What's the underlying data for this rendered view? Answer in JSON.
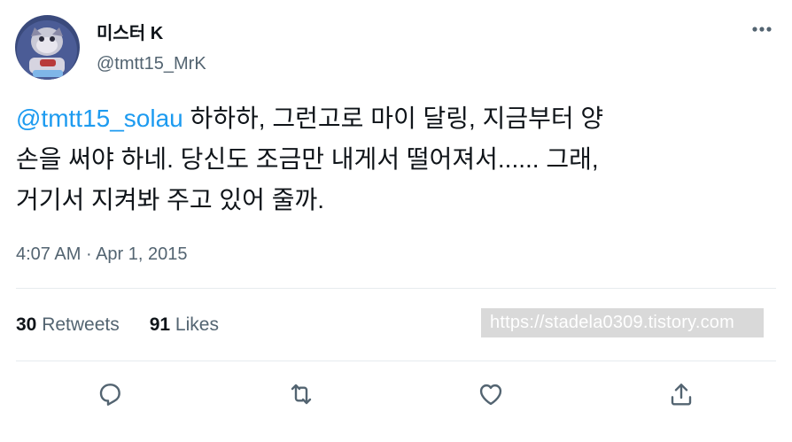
{
  "tweet": {
    "author": {
      "display_name": "미스터 K",
      "handle": "@tmtt15_MrK",
      "avatar_icon": "avatar-icon"
    },
    "more_icon": "more-dots-icon",
    "text": {
      "mention": "@tmtt15_solau",
      "line1_rest": " 하하하, 그런고로 마이 달링, 지금부터 양",
      "line2": "손을 써야 하네. 당신도 조금만 내게서 떨어져서...... 그래,",
      "line3": "거기서 지켜봐 주고 있어 줄까."
    },
    "time": "4:07 AM",
    "separator": " · ",
    "date": "Apr 1, 2015",
    "stats": {
      "retweets_count": "30",
      "retweets_label": " Retweets",
      "likes_count": "91",
      "likes_label": " Likes"
    },
    "watermark": "https://stadela0309.tistory.com",
    "actions": [
      "reply-icon",
      "retweet-icon",
      "like-icon",
      "share-icon"
    ],
    "colors": {
      "link": "#1d9bf0",
      "secondary_text": "#536471",
      "primary_text": "#0f1419",
      "divider": "#e6ebee"
    }
  }
}
